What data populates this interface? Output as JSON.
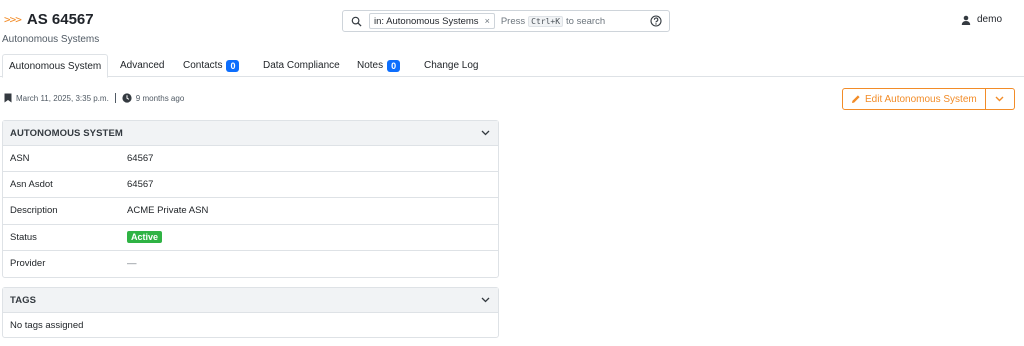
{
  "header": {
    "chevrons": ">>>",
    "title": "AS 64567",
    "subtitle": "Autonomous Systems"
  },
  "search": {
    "chip_label": "in: Autonomous Systems",
    "chip_close": "×",
    "hint_pre": "Press",
    "hint_key": "Ctrl+K",
    "hint_post": "to search"
  },
  "user": {
    "name": "demo"
  },
  "tabs": [
    {
      "label": "Autonomous System",
      "active": true
    },
    {
      "label": "Advanced"
    },
    {
      "label": "Contacts",
      "badge": "0"
    },
    {
      "label": "Data Compliance"
    },
    {
      "label": "Notes",
      "badge": "0"
    },
    {
      "label": "Change Log"
    }
  ],
  "meta": {
    "created": "March 11, 2025, 3:35 p.m.",
    "updated": "9 months ago"
  },
  "actions": {
    "edit_label": "Edit Autonomous System"
  },
  "panel_as": {
    "title": "AUTONOMOUS SYSTEM",
    "rows": [
      {
        "key": "ASN",
        "value": "64567"
      },
      {
        "key": "Asn Asdot",
        "value": "64567"
      },
      {
        "key": "Description",
        "value": "ACME Private ASN"
      },
      {
        "key": "Status",
        "value": "Active"
      },
      {
        "key": "Provider",
        "value": "—"
      }
    ]
  },
  "panel_tags": {
    "title": "TAGS",
    "empty": "No tags assigned"
  },
  "colors": {
    "accent": "#f28c28",
    "badge": "#0d6efd",
    "status_active": "#2fb344"
  }
}
